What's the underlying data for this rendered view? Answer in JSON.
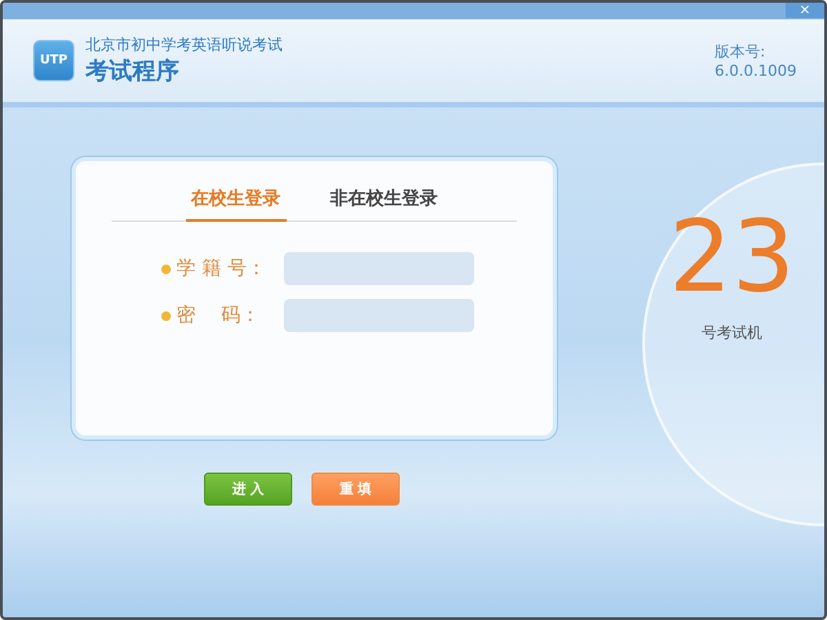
{
  "window": {
    "close": "×"
  },
  "header": {
    "logo": "UTP",
    "subtitle": "北京市初中学考英语听说考试",
    "title": "考试程序",
    "version_label": "版本号:",
    "version": "6.0.0.1009"
  },
  "tabs": [
    {
      "label": "在校生登录",
      "selected": true
    },
    {
      "label": "非在校生登录",
      "selected": false
    }
  ],
  "fields": [
    {
      "label": "学 籍 号："
    },
    {
      "label": "密　 码："
    }
  ],
  "buttons": [
    {
      "label": "进 入",
      "kind": "primary"
    },
    {
      "label": "重 填",
      "kind": "secondary"
    }
  ],
  "machine": {
    "number": "23",
    "caption": "号考试机"
  }
}
